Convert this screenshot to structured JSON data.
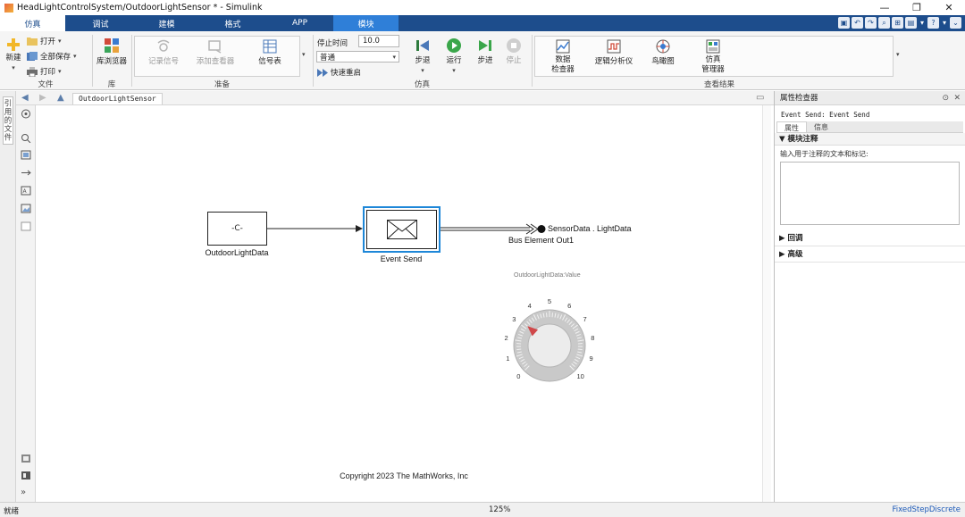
{
  "window": {
    "title": "HeadLightControlSystem/OutdoorLightSensor * - Simulink",
    "minimize": "—",
    "restore": "❐",
    "close": "✕"
  },
  "tabs": [
    "仿真",
    "调试",
    "建模",
    "格式",
    "APP",
    "模块"
  ],
  "toolstrip": {
    "file": {
      "new_label": "新建",
      "open_label": "打开",
      "save_all_label": "全部保存",
      "print_label": "打印",
      "group_label": "文件"
    },
    "library": {
      "library_browser_label": "库浏览器",
      "group_label": "库"
    },
    "prepare": {
      "log_signals_label": "记录信号",
      "add_viewer_label": "添加查看器",
      "signal_table_label": "信号表",
      "group_label": "准备"
    },
    "simulate": {
      "stop_time_label": "停止时间",
      "stop_time_value": "10.0",
      "mode_value": "普通",
      "fast_restart_label": "快速重启",
      "step_back_label": "步退",
      "run_label": "运行",
      "step_forward_label": "步进",
      "stop_label": "停止",
      "group_label": "仿真"
    },
    "review": {
      "data_inspector_label": "数据\n检查器",
      "logic_analyzer_label": "逻辑分析仪",
      "birds_eye_label": "鸟瞰图",
      "sim_manager_label": "仿真\n管理器",
      "group_label": "查看结果"
    }
  },
  "explorer": {
    "breadcrumb": "OutdoorLightSensor",
    "side_panel_label": "引用的文件"
  },
  "model": {
    "constant_block": {
      "display": "-C-",
      "name": "OutdoorLightData"
    },
    "event_send_block": {
      "name": "Event Send"
    },
    "bus_element_out": {
      "signal_label": "SensorData . LightData",
      "name": "Bus Element Out1"
    },
    "knob": {
      "title": "OutdoorLightData:Value",
      "ticks": [
        "0",
        "1",
        "2",
        "3",
        "4",
        "5",
        "6",
        "7",
        "8",
        "9",
        "10"
      ],
      "value": 3.2,
      "min": 0,
      "max": 10
    },
    "copyright": "Copyright 2023 The MathWorks, Inc"
  },
  "inspector": {
    "title": "属性检查器",
    "selected_block": "Event Send: Event Send",
    "tabs": [
      "属性",
      "信息"
    ],
    "section_annotation": "模块注释",
    "annotation_hint": "输入用于注释的文本和标记:",
    "section_callbacks": "回调",
    "section_advanced": "高级"
  },
  "status": {
    "left": "就绪",
    "zoom": "125%",
    "solver": "FixedStepDiscrete"
  },
  "colors": {
    "tab_bar": "#1d4d8c",
    "selection": "#1e87d8",
    "status_link": "#1a58b8"
  }
}
